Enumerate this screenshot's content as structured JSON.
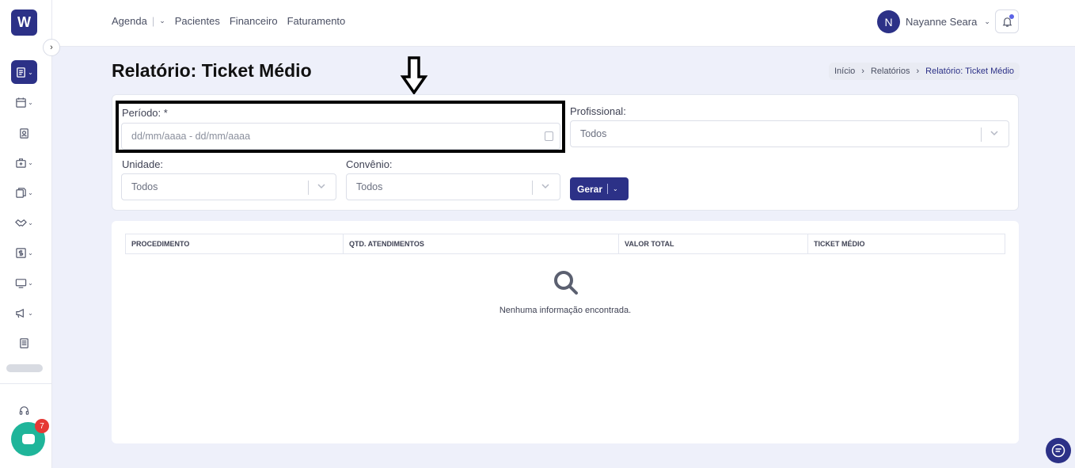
{
  "app": {
    "logo_letter": "W"
  },
  "topnav": {
    "items": [
      "Agenda",
      "Pacientes",
      "Financeiro",
      "Faturamento"
    ]
  },
  "user": {
    "initial": "N",
    "name": "Nayanne Seara"
  },
  "page": {
    "title": "Relatório: Ticket Médio"
  },
  "breadcrumb": {
    "items": [
      "Início",
      "Relatórios",
      "Relatório: Ticket Médio"
    ]
  },
  "filters": {
    "periodo_label": "Período: *",
    "periodo_placeholder": "dd/mm/aaaa - dd/mm/aaaa",
    "profissional_label": "Profissional:",
    "profissional_value": "Todos",
    "unidade_label": "Unidade:",
    "unidade_value": "Todos",
    "convenio_label": "Convênio:",
    "convenio_value": "Todos",
    "gerar_label": "Gerar"
  },
  "table": {
    "columns": [
      "PROCEDIMENTO",
      "QTD. ATENDIMENTOS",
      "VALOR TOTAL",
      "TICKET MÉDIO"
    ],
    "empty_message": "Nenhuma informação encontrada."
  },
  "chat": {
    "badge_count": "7"
  },
  "colors": {
    "primary": "#2c3187",
    "chat": "#1fb59a",
    "badge": "#e53935"
  }
}
